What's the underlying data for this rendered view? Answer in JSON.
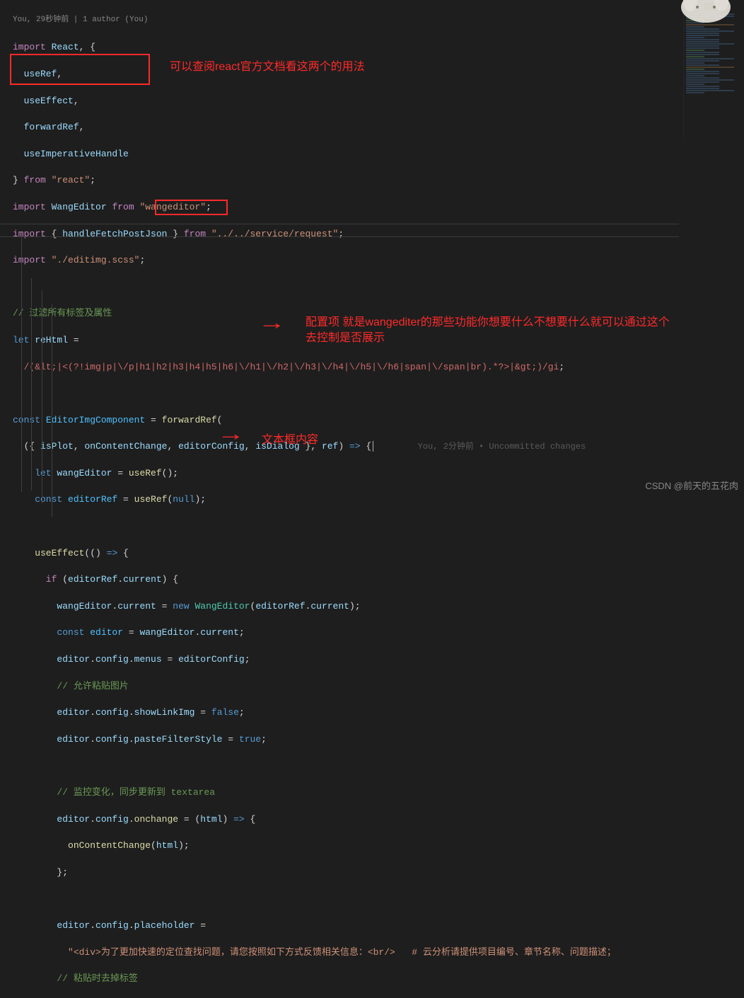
{
  "codelens": "You, 29秒钟前 | 1 author (You)",
  "blame": "You, 2分钟前 • Uncommitted changes",
  "annotations": {
    "anno1": "可以查阅react官方文档看这两个的用法",
    "anno2": "配置项 就是wangediter的那些功能你想要什么不想要什么就可以通过这个去控制是否展示",
    "anno3": "文本框内容"
  },
  "watermark": "CSDN @前天的五花肉",
  "code": {
    "l1a": "import",
    "l1b": " React",
    "l1c": ", {",
    "l2a": "  useRef",
    "l2b": ",",
    "l3a": "  useEffect",
    "l3b": ",",
    "l4a": "  forwardRef",
    "l4b": ",",
    "l5a": "  useImperativeHandle",
    "l6a": "} ",
    "l6b": "from",
    "l6c": " \"react\"",
    "l6d": ";",
    "l7a": "import",
    "l7b": " WangEditor ",
    "l7c": "from",
    "l7d": " \"wangeditor\"",
    "l7e": ";",
    "l8a": "import",
    "l8b": " { ",
    "l8c": "handleFetchPostJson",
    "l8d": " } ",
    "l8e": "from",
    "l8f": " \"../../service/request\"",
    "l8g": ";",
    "l9a": "import",
    "l9b": " \"./editimg.scss\"",
    "l9c": ";",
    "l11": "// 过滤所有标签及属性",
    "l12a": "let",
    "l12b": " reHtml",
    "l12c": " =",
    "l13": "  /(&lt;|<(?!img|p|\\/p|h1|h2|h3|h4|h5|h6|\\/h1|\\/h2|\\/h3|\\/h4|\\/h5|\\/h6|span|\\/span|br).*?>|&gt;)/gi",
    "l13b": ";",
    "l15a": "const",
    "l15b": " EditorImgComponent",
    "l15c": " = ",
    "l15d": "forwardRef",
    "l15e": "(",
    "l16a": "  ({ ",
    "l16b": "isPlot",
    "l16c": ", ",
    "l16d": "onContentChange",
    "l16e": ", ",
    "l16f": "editorConfig",
    "l16g": ", ",
    "l16h": "isDialog",
    "l16i": " }, ",
    "l16j": "ref",
    "l16k": ") ",
    "l16l": "=>",
    "l16m": " {",
    "l17a": "    let",
    "l17b": " wangEditor",
    "l17c": " = ",
    "l17d": "useRef",
    "l17e": "();",
    "l18a": "    const",
    "l18b": " editorRef",
    "l18c": " = ",
    "l18d": "useRef",
    "l18e": "(",
    "l18f": "null",
    "l18g": ");",
    "l20a": "    useEffect",
    "l20b": "(() ",
    "l20c": "=>",
    "l20d": " {",
    "l21a": "      if",
    "l21b": " (",
    "l21c": "editorRef",
    "l21d": ".",
    "l21e": "current",
    "l21f": ") {",
    "l22a": "        wangEditor",
    "l22b": ".",
    "l22c": "current",
    "l22d": " = ",
    "l22e": "new",
    "l22f": " WangEditor",
    "l22g": "(",
    "l22h": "editorRef",
    "l22i": ".",
    "l22j": "current",
    "l22k": ");",
    "l23a": "        const",
    "l23b": " editor",
    "l23c": " = ",
    "l23d": "wangEditor",
    "l23e": ".",
    "l23f": "current",
    "l23g": ";",
    "l24a": "        editor",
    "l24b": ".",
    "l24c": "config",
    "l24d": ".",
    "l24e": "menus",
    "l24f": " = ",
    "l24g": "editorConfig",
    "l24h": ";",
    "l25": "        // 允许粘贴图片",
    "l26a": "        editor",
    "l26b": ".",
    "l26c": "config",
    "l26d": ".",
    "l26e": "showLinkImg",
    "l26f": " = ",
    "l26g": "false",
    "l26h": ";",
    "l27a": "        editor",
    "l27b": ".",
    "l27c": "config",
    "l27d": ".",
    "l27e": "pasteFilterStyle",
    "l27f": " = ",
    "l27g": "true",
    "l27h": ";",
    "l29": "        // 监控变化，同步更新到 textarea",
    "l30a": "        editor",
    "l30b": ".",
    "l30c": "config",
    "l30d": ".",
    "l30e": "onchange",
    "l30f": " = (",
    "l30g": "html",
    "l30h": ") ",
    "l30i": "=>",
    "l30j": " {",
    "l31a": "          onContentChange",
    "l31b": "(",
    "l31c": "html",
    "l31d": ");",
    "l32": "        };",
    "l34a": "        editor",
    "l34b": ".",
    "l34c": "config",
    "l34d": ".",
    "l34e": "placeholder",
    "l34f": " =",
    "l35a": "          \"<div>为了更加快速的定位查找问题，请您按照如下方式反馈相关信息：<br/>   # 云分析请提供项目编号、章节名称、问题描述；",
    "l36": "        // 粘贴时去掉标签"
  }
}
